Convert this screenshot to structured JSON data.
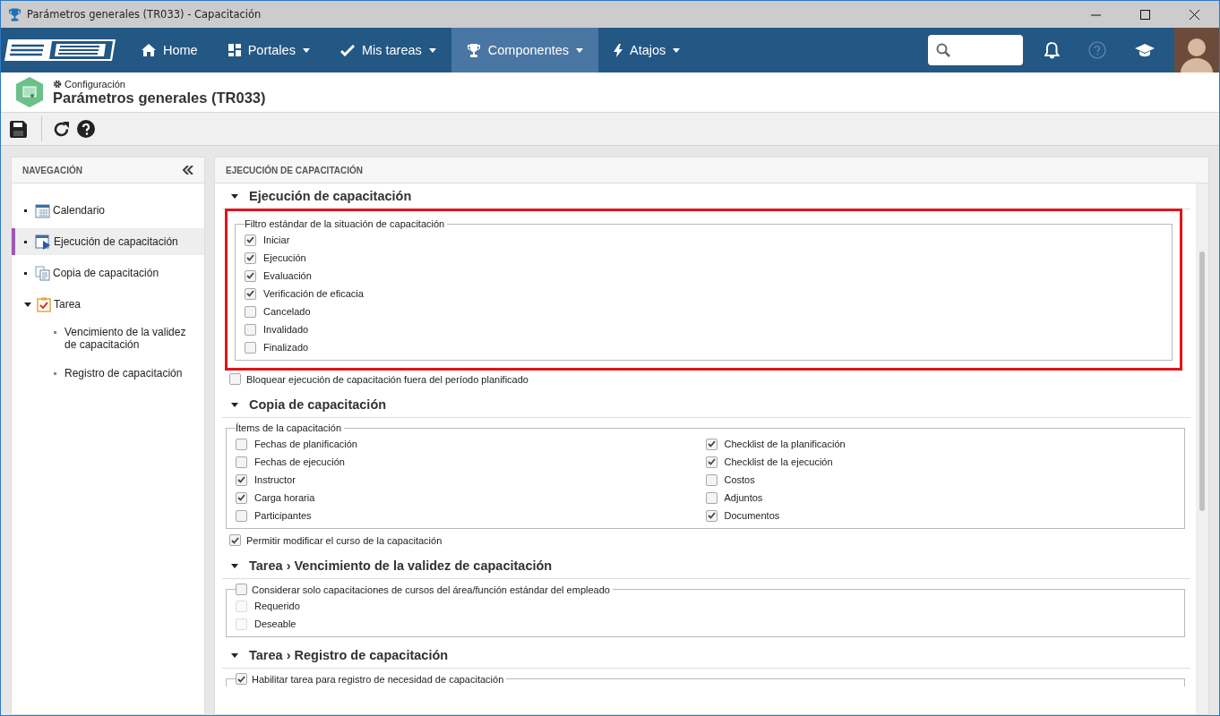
{
  "window": {
    "title": "Parámetros generales (TR033) - Capacitación"
  },
  "nav": {
    "items": [
      {
        "label": "Home",
        "selected": false,
        "caret": false
      },
      {
        "label": "Portales",
        "selected": false,
        "caret": true
      },
      {
        "label": "Mis tareas",
        "selected": false,
        "caret": true
      },
      {
        "label": "Componentes",
        "selected": true,
        "caret": true
      },
      {
        "label": "Atajos",
        "selected": false,
        "caret": true
      }
    ]
  },
  "header": {
    "breadcrumb": "Configuración",
    "title": "Parámetros generales (TR033)"
  },
  "sidebar": {
    "heading": "NAVEGACIÓN",
    "items": [
      {
        "label": "Calendario",
        "selected": false
      },
      {
        "label": "Ejecución de capacitación",
        "selected": true
      },
      {
        "label": "Copia de capacitación",
        "selected": false
      },
      {
        "label": "Tarea",
        "selected": false,
        "expanded": true,
        "children": [
          {
            "label": "Vencimiento de la validez de capacitación",
            "selected": false
          },
          {
            "label": "Registro de capacitación",
            "selected": false
          }
        ]
      }
    ]
  },
  "panel": {
    "heading": "EJECUCIÓN DE CAPACITACIÓN",
    "sections": [
      {
        "title": "Ejecución de capacitación",
        "expanded": true,
        "blocks": [
          {
            "kind": "fieldset",
            "legend": "Filtro estándar de la situación de capacitación",
            "highlighted": true,
            "columns": [
              [
                {
                  "label": "Iniciar",
                  "checked": true,
                  "disabled": false
                },
                {
                  "label": "Ejecución",
                  "checked": true,
                  "disabled": false
                },
                {
                  "label": "Evaluación",
                  "checked": true,
                  "disabled": false
                },
                {
                  "label": "Verificación de eficacia",
                  "checked": true,
                  "disabled": false
                },
                {
                  "label": "Cancelado",
                  "checked": false,
                  "disabled": false
                },
                {
                  "label": "Invalidado",
                  "checked": false,
                  "disabled": false
                },
                {
                  "label": "Finalizado",
                  "checked": false,
                  "disabled": false
                }
              ]
            ]
          },
          {
            "kind": "checkbox",
            "label": "Bloquear ejecución de capacitación fuera del período planificado",
            "checked": false
          }
        ]
      },
      {
        "title": "Copia de capacitación",
        "expanded": true,
        "blocks": [
          {
            "kind": "fieldset",
            "legend": "Ítems de la capacitación",
            "highlighted": false,
            "columns": [
              [
                {
                  "label": "Fechas de planificación",
                  "checked": false,
                  "disabled": false
                },
                {
                  "label": "Fechas de ejecución",
                  "checked": false,
                  "disabled": false
                },
                {
                  "label": "Instructor",
                  "checked": true,
                  "disabled": false
                },
                {
                  "label": "Carga horaria",
                  "checked": true,
                  "disabled": false
                },
                {
                  "label": "Participantes",
                  "checked": false,
                  "disabled": false
                }
              ],
              [
                {
                  "label": "Checklist de la planificación",
                  "checked": true,
                  "disabled": false
                },
                {
                  "label": "Checklist de la ejecución",
                  "checked": true,
                  "disabled": false
                },
                {
                  "label": "Costos",
                  "checked": false,
                  "disabled": false
                },
                {
                  "label": "Adjuntos",
                  "checked": false,
                  "disabled": false
                },
                {
                  "label": "Documentos",
                  "checked": true,
                  "disabled": false
                }
              ]
            ]
          },
          {
            "kind": "checkbox",
            "label": "Permitir modificar el curso de la capacitación",
            "checked": true
          }
        ]
      },
      {
        "title": "Tarea › Vencimiento de la validez de capacitación",
        "expanded": true,
        "blocks": [
          {
            "kind": "fieldset",
            "legend": "Considerar solo capacitaciones de cursos del área/función estándar del empleado",
            "legend_checked": false,
            "highlighted": false,
            "columns": [
              [
                {
                  "label": "Requerido",
                  "checked": false,
                  "disabled": true
                },
                {
                  "label": "Deseable",
                  "checked": false,
                  "disabled": true
                }
              ]
            ]
          }
        ]
      },
      {
        "title": "Tarea › Registro de capacitación",
        "expanded": true,
        "blocks": [
          {
            "kind": "fieldset",
            "legend": "Habilitar tarea para registro de necesidad de capacitación",
            "legend_checked": true,
            "highlighted": false
          }
        ]
      }
    ]
  }
}
